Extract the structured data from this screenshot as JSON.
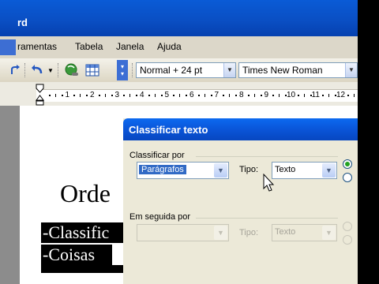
{
  "window": {
    "title_fragment": "rd"
  },
  "menu": [
    "ramentas",
    "Tabela",
    "Janela",
    "Ajuda"
  ],
  "toolbar": {
    "style": "Normal + 24 pt",
    "font": "Times New Roman"
  },
  "ruler": {
    "numbers": [
      "1",
      "2",
      "3",
      "4",
      "5",
      "6",
      "7",
      "8",
      "9",
      "10",
      "11",
      "12"
    ]
  },
  "document": {
    "heading": "Orde",
    "lines": [
      "-Classific",
      "-Coisas"
    ]
  },
  "dialog": {
    "title": "Classificar texto",
    "sort_by": {
      "label": "Classificar por",
      "field": "Parágrafos",
      "type_label": "Tipo:",
      "type_value": "Texto"
    },
    "then_by": {
      "label": "Em seguida por",
      "field": "",
      "type_label": "Tipo:",
      "type_value": "Texto"
    }
  }
}
